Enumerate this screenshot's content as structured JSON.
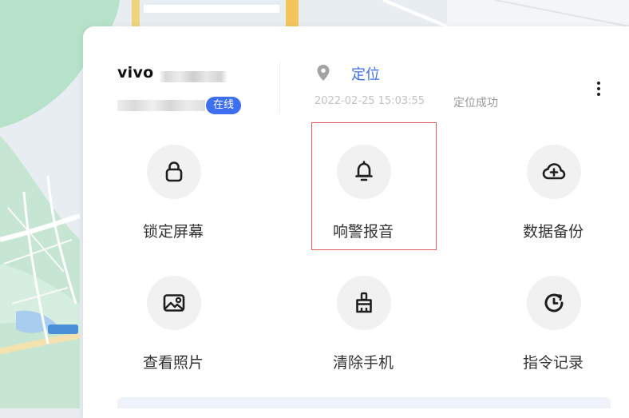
{
  "device": {
    "name": "vivo",
    "status_badge": "在线"
  },
  "location": {
    "label": "定位",
    "timestamp": "2022-02-25 15:03:55",
    "status": "定位成功"
  },
  "actions": [
    {
      "id": "lock",
      "label": "锁定屏幕",
      "icon": "lock-icon"
    },
    {
      "id": "alarm",
      "label": "响警报音",
      "icon": "bell-icon"
    },
    {
      "id": "backup",
      "label": "数据备份",
      "icon": "cloud-plus-icon"
    },
    {
      "id": "photos",
      "label": "查看照片",
      "icon": "image-icon"
    },
    {
      "id": "wipe",
      "label": "清除手机",
      "icon": "brush-icon"
    },
    {
      "id": "history",
      "label": "指令记录",
      "icon": "clock-history-icon"
    }
  ],
  "colors": {
    "accent": "#3d6ff0",
    "highlight_border": "#e35c5c",
    "icon_bg": "#f1f1f1"
  }
}
